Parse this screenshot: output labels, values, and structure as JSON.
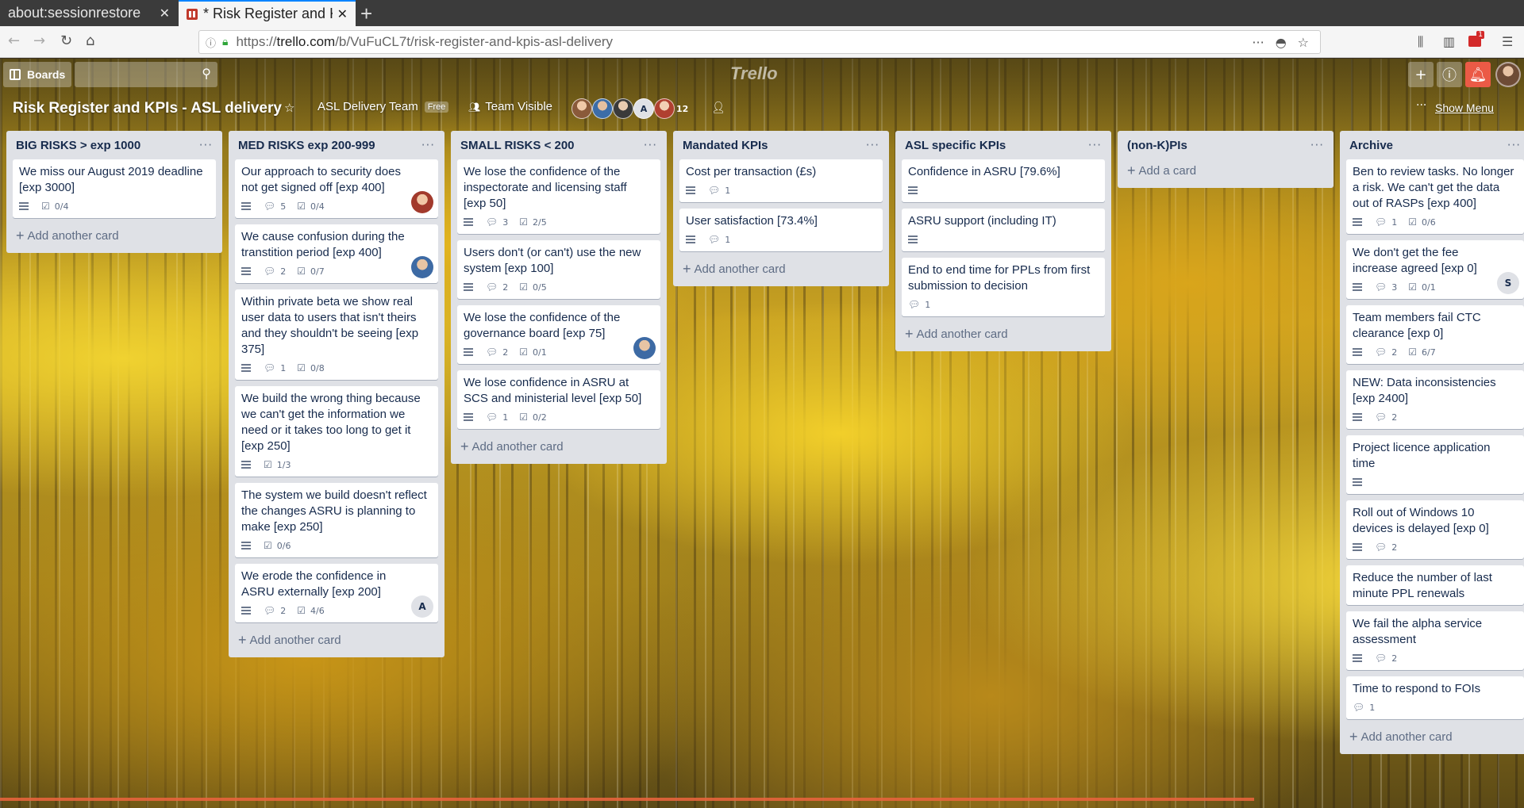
{
  "browser": {
    "tabs": [
      {
        "title": "about:sessionrestore",
        "close": "✕"
      },
      {
        "title": "* Risk Register and K",
        "close": "✕"
      }
    ],
    "new_tab": "+",
    "url": {
      "prefix": "https://",
      "host": "trello.com",
      "path": "/b/VuFuCL7t/risk-register-and-kpis-asl-delivery"
    },
    "notif_count": "1"
  },
  "trello": {
    "boards_label": "Boards",
    "logo": "Trello"
  },
  "board": {
    "title": "Risk Register and KPIs - ASL delivery",
    "team": "ASL Delivery Team",
    "free": "Free",
    "visibility": "Team Visible",
    "member_count": "12",
    "member_letter": "A",
    "show_menu": "Show Menu",
    "menu_dots": "···"
  },
  "lists": [
    {
      "title": "BIG RISKS > exp 1000",
      "add_label": "Add another card",
      "cards": [
        {
          "title": "We miss our August 2019 deadline [exp 3000]",
          "desc": true,
          "checklist": "0/4"
        }
      ]
    },
    {
      "title": "MED RISKS exp 200-999",
      "add_label": "Add another card",
      "cards": [
        {
          "title": "Our approach to security does not get signed off [exp 400]",
          "desc": true,
          "comments": "5",
          "checklist": "0/4",
          "avatar": "photo-red"
        },
        {
          "title": "We cause confusion during the transtition period [exp 400]",
          "desc": true,
          "comments": "2",
          "checklist": "0/7",
          "avatar": "photo-blue"
        },
        {
          "title": "Within private beta we show real user data to users that isn't theirs and they shouldn't be seeing [exp 375]",
          "desc": true,
          "comments": "1",
          "checklist": "0/8"
        },
        {
          "title": "We build the wrong thing because we can't get the information we need or it takes too long to get it [exp 250]",
          "desc": true,
          "checklist": "1/3"
        },
        {
          "title": "The system we build doesn't reflect the changes ASRU is planning to make [exp 250]",
          "desc": true,
          "checklist": "0/6"
        },
        {
          "title": "We erode the confidence in ASRU externally [exp 200]",
          "desc": true,
          "comments": "2",
          "checklist": "4/6",
          "avatar_letter": "A"
        }
      ]
    },
    {
      "title": "SMALL RISKS < 200",
      "add_label": "Add another card",
      "cards": [
        {
          "title": "We lose the confidence of the inspectorate and licensing staff [exp 50]",
          "desc": true,
          "comments": "3",
          "checklist": "2/5"
        },
        {
          "title": "Users don't (or can't) use the new system [exp 100]",
          "desc": true,
          "comments": "2",
          "checklist": "0/5"
        },
        {
          "title": "We lose the confidence of the governance board [exp 75]",
          "desc": true,
          "comments": "2",
          "checklist": "0/1",
          "avatar": "photo-blue"
        },
        {
          "title": "We lose confidence in ASRU at SCS and ministerial level [exp 50]",
          "desc": true,
          "comments": "1",
          "checklist": "0/2"
        }
      ]
    },
    {
      "title": "Mandated KPIs",
      "add_label": "Add another card",
      "cards": [
        {
          "title": "Cost per transaction (£s)",
          "desc": true,
          "comments": "1"
        },
        {
          "title": "User satisfaction [73.4%]",
          "desc": true,
          "comments": "1"
        }
      ]
    },
    {
      "title": "ASL specific KPIs",
      "add_label": "Add another card",
      "cards": [
        {
          "title": "Confidence in ASRU [79.6%]",
          "desc": true
        },
        {
          "title": "ASRU support (including IT)",
          "desc": true
        },
        {
          "title": "End to end time for PPLs from first submission to decision",
          "comments": "1"
        }
      ]
    },
    {
      "title": "(non-K)PIs",
      "add_label": "Add a card",
      "cards": []
    },
    {
      "title": "Archive",
      "add_label": "Add another card",
      "cards": [
        {
          "title": "Ben to review tasks. No longer a risk. We can't get the data out of RASPs [exp 400]",
          "desc": true,
          "comments": "1",
          "checklist": "0/6"
        },
        {
          "title": "We don't get the fee increase agreed [exp 0]",
          "desc": true,
          "comments": "3",
          "checklist": "0/1",
          "avatar_letter": "S"
        },
        {
          "title": "Team members fail CTC clearance [exp 0]",
          "desc": true,
          "comments": "2",
          "checklist": "6/7"
        },
        {
          "title": "NEW: Data inconsistencies [exp 2400]",
          "desc": true,
          "comments": "2"
        },
        {
          "title": "Project licence application time",
          "desc": true
        },
        {
          "title": "Roll out of Windows 10 devices is delayed [exp 0]",
          "desc": true,
          "comments": "2"
        },
        {
          "title": "Reduce the number of last minute PPL renewals"
        },
        {
          "title": "We fail the alpha service assessment",
          "desc": true,
          "comments": "2"
        },
        {
          "title": "Time to respond to FOIs",
          "comments": "1"
        }
      ]
    }
  ],
  "colors": {
    "list_bg": "#dfe1e6",
    "text_primary": "#172b4d",
    "text_muted": "#5e6c84",
    "notification_red": "#eb5a46"
  }
}
